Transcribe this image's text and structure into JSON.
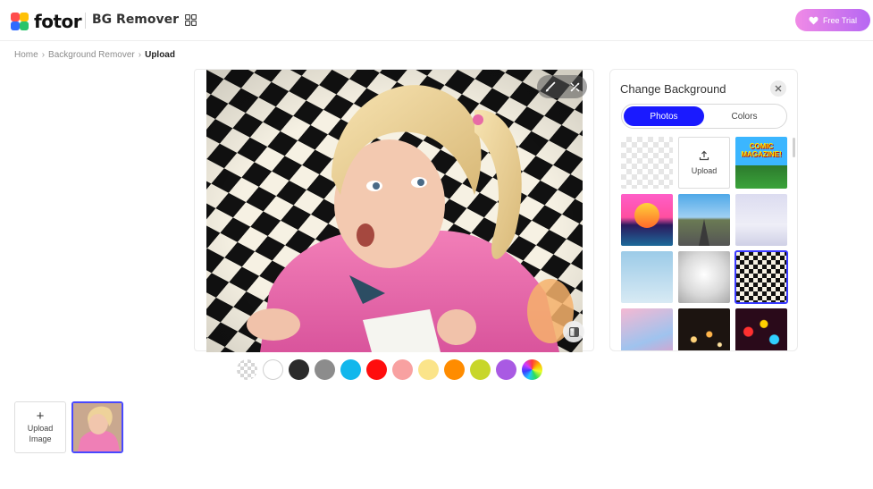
{
  "header": {
    "logo_text": "fotor",
    "product_name": "BG Remover",
    "trial_button": "Free Trial",
    "icons": {
      "apps": "grid-apps-icon",
      "trial": "heart-icon"
    }
  },
  "breadcrumb": {
    "items": [
      "Home",
      "Background Remover"
    ],
    "current": "Upload"
  },
  "canvas": {
    "tools": [
      "brush-icon",
      "eraser-icon"
    ],
    "compare": "compare-icon"
  },
  "swatches": {
    "colors": [
      "transparent",
      "#ffffff",
      "#2b2b2b",
      "#8c8c8c",
      "#12b7ec",
      "#ff0d0d",
      "#f8a1a1",
      "#fbe48a",
      "#ff8c00",
      "#c8d62a",
      "#a95ae3",
      "rainbow"
    ]
  },
  "panel": {
    "title": "Change Background",
    "tabs": {
      "photos": "Photos",
      "colors": "Colors",
      "active": "Photos"
    },
    "upload_label": "Upload",
    "tiles": [
      "transparent",
      "upload",
      "comic-magazine",
      "sunset-grid",
      "road",
      "studio-gray",
      "sky-blue",
      "gray-radial",
      "checker-warp",
      "pink-clouds",
      "bokeh-lights",
      "color-bokeh"
    ],
    "selected_tile": "checker-warp",
    "comic_text": "COMIC MAGAZINE!"
  },
  "bottom": {
    "upload_image": "Upload Image",
    "upload_line1": "Upload",
    "upload_line2": "Image"
  },
  "colors": {
    "accent": "#1a1aff",
    "trial_gradient_start": "#f08ae6",
    "trial_gradient_end": "#b667f3"
  }
}
